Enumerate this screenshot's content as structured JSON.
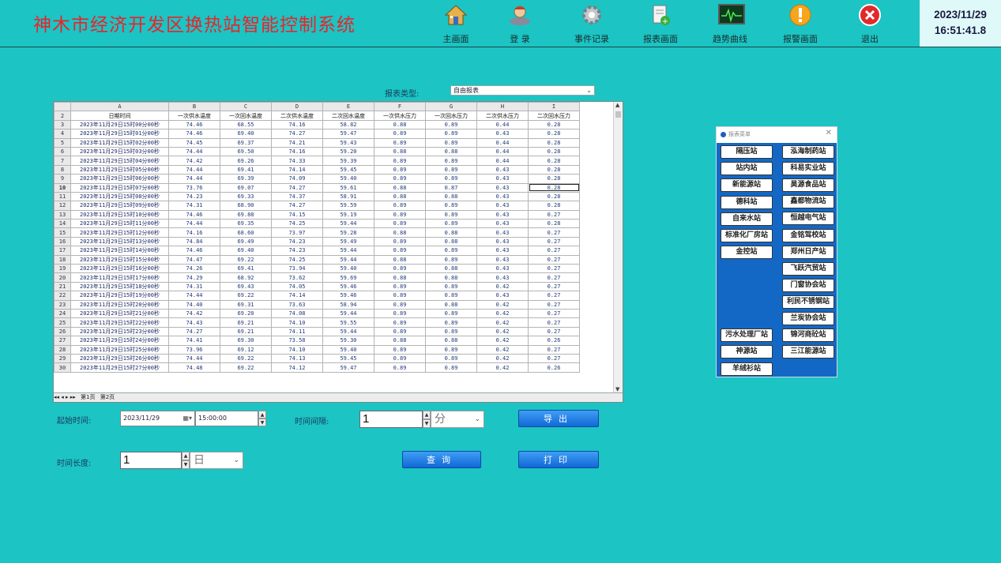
{
  "header": {
    "title": "神木市经济开发区换热站智能控制系统",
    "nav": [
      {
        "label": "主画面",
        "icon": "home-icon"
      },
      {
        "label": "登  录",
        "icon": "user-login-icon"
      },
      {
        "label": "事件记录",
        "icon": "gear-event-icon"
      },
      {
        "label": "报表画面",
        "icon": "report-add-icon"
      },
      {
        "label": "趋势曲线",
        "icon": "trend-monitor-icon"
      },
      {
        "label": "报警画面",
        "icon": "alarm-icon"
      },
      {
        "label": "退出",
        "icon": "exit-icon"
      }
    ],
    "date": "2023/11/29",
    "time": "16:51:41.8"
  },
  "report_type": {
    "label": "报表类型:",
    "value": "自由报表"
  },
  "sheet": {
    "col_letters": [
      "A",
      "B",
      "C",
      "D",
      "E",
      "F",
      "G",
      "H",
      "I"
    ],
    "headers": [
      "日期时间",
      "一次供水温度",
      "一次回水温度",
      "二次供水温度",
      "二次回水温度",
      "一次供水压力",
      "一次回水压力",
      "二次供水压力",
      "二次回水压力"
    ],
    "rows": [
      [
        "2023年11月29日15时00分00秒",
        "74.46",
        "68.55",
        "74.16",
        "58.82",
        "0.88",
        "0.89",
        "0.44",
        "0.28"
      ],
      [
        "2023年11月29日15时01分00秒",
        "74.46",
        "69.40",
        "74.27",
        "59.47",
        "0.89",
        "0.89",
        "0.43",
        "0.28"
      ],
      [
        "2023年11月29日15时02分00秒",
        "74.45",
        "69.37",
        "74.21",
        "59.43",
        "0.89",
        "0.89",
        "0.44",
        "0.28"
      ],
      [
        "2023年11月29日15时03分00秒",
        "74.44",
        "69.50",
        "74.16",
        "59.20",
        "0.88",
        "0.88",
        "0.44",
        "0.28"
      ],
      [
        "2023年11月29日15时04分00秒",
        "74.42",
        "69.26",
        "74.33",
        "59.39",
        "0.89",
        "0.89",
        "0.44",
        "0.28"
      ],
      [
        "2023年11月29日15时05分00秒",
        "74.44",
        "69.41",
        "74.14",
        "59.45",
        "0.89",
        "0.89",
        "0.43",
        "0.28"
      ],
      [
        "2023年11月29日15时06分00秒",
        "74.44",
        "69.39",
        "74.09",
        "59.40",
        "0.89",
        "0.89",
        "0.43",
        "0.28"
      ],
      [
        "2023年11月29日15时07分00秒",
        "73.76",
        "69.07",
        "74.27",
        "59.61",
        "0.88",
        "0.87",
        "0.43",
        "0.28"
      ],
      [
        "2023年11月29日15时08分00秒",
        "74.23",
        "69.33",
        "74.37",
        "58.91",
        "0.88",
        "0.88",
        "0.43",
        "0.28"
      ],
      [
        "2023年11月29日15时09分00秒",
        "74.31",
        "68.90",
        "74.27",
        "59.59",
        "0.89",
        "0.89",
        "0.43",
        "0.28"
      ],
      [
        "2023年11月29日15时10分00秒",
        "74.46",
        "69.88",
        "74.15",
        "59.19",
        "0.89",
        "0.89",
        "0.43",
        "0.27"
      ],
      [
        "2023年11月29日15时11分00秒",
        "74.44",
        "69.35",
        "74.25",
        "59.44",
        "0.89",
        "0.89",
        "0.43",
        "0.28"
      ],
      [
        "2023年11月29日15时12分00秒",
        "74.16",
        "68.60",
        "73.97",
        "59.28",
        "0.88",
        "0.88",
        "0.43",
        "0.27"
      ],
      [
        "2023年11月29日15时13分00秒",
        "74.84",
        "69.49",
        "74.23",
        "59.49",
        "0.89",
        "0.88",
        "0.43",
        "0.27"
      ],
      [
        "2023年11月29日15时14分00秒",
        "74.46",
        "69.40",
        "74.23",
        "59.44",
        "0.89",
        "0.89",
        "0.43",
        "0.27"
      ],
      [
        "2023年11月29日15时15分00秒",
        "74.47",
        "69.22",
        "74.25",
        "59.44",
        "0.88",
        "0.89",
        "0.43",
        "0.27"
      ],
      [
        "2023年11月29日15时16分00秒",
        "74.26",
        "69.41",
        "73.94",
        "59.40",
        "0.89",
        "0.88",
        "0.43",
        "0.27"
      ],
      [
        "2023年11月29日15时17分00秒",
        "74.29",
        "68.92",
        "73.62",
        "59.69",
        "0.88",
        "0.88",
        "0.43",
        "0.27"
      ],
      [
        "2023年11月29日15时18分00秒",
        "74.31",
        "69.43",
        "74.05",
        "59.46",
        "0.89",
        "0.89",
        "0.42",
        "0.27"
      ],
      [
        "2023年11月29日15时19分00秒",
        "74.44",
        "69.22",
        "74.14",
        "59.46",
        "0.89",
        "0.89",
        "0.43",
        "0.27"
      ],
      [
        "2023年11月29日15时20分00秒",
        "74.40",
        "69.31",
        "73.63",
        "58.94",
        "0.89",
        "0.88",
        "0.42",
        "0.27"
      ],
      [
        "2023年11月29日15时21分00秒",
        "74.42",
        "69.20",
        "74.08",
        "59.44",
        "0.89",
        "0.89",
        "0.42",
        "0.27"
      ],
      [
        "2023年11月29日15时22分00秒",
        "74.43",
        "69.21",
        "74.10",
        "59.55",
        "0.89",
        "0.89",
        "0.42",
        "0.27"
      ],
      [
        "2023年11月29日15时23分00秒",
        "74.27",
        "69.21",
        "74.11",
        "59.44",
        "0.89",
        "0.89",
        "0.42",
        "0.27"
      ],
      [
        "2023年11月29日15时24分00秒",
        "74.41",
        "69.30",
        "73.58",
        "59.30",
        "0.88",
        "0.88",
        "0.42",
        "0.26"
      ],
      [
        "2023年11月29日15时25分00秒",
        "73.96",
        "69.12",
        "74.10",
        "59.40",
        "0.89",
        "0.89",
        "0.42",
        "0.27"
      ],
      [
        "2023年11月29日15时26分00秒",
        "74.44",
        "69.22",
        "74.13",
        "59.45",
        "0.89",
        "0.89",
        "0.42",
        "0.27"
      ],
      [
        "2023年11月29日15时27分00秒",
        "74.48",
        "69.22",
        "74.12",
        "59.47",
        "0.89",
        "0.89",
        "0.42",
        "0.26"
      ]
    ],
    "tabs": [
      "◂◂ ◂ ▸ ▸▸",
      "第1页",
      "第2页"
    ]
  },
  "controls": {
    "start_label": "起始时间:",
    "start_date": "2023/11/29",
    "start_time": "15:00:00",
    "interval_label": "时间间隔:",
    "interval_value": "1",
    "interval_unit": "分",
    "length_label": "时间长度:",
    "length_value": "1",
    "length_unit": "日",
    "export_label": "导出",
    "query_label": "查询",
    "print_label": "打印"
  },
  "station_panel": {
    "title": "报表菜单",
    "left": [
      "隔压站",
      "站内站",
      "新能源站",
      "德科站",
      "自来水站",
      "标准化厂房站",
      "金控站",
      "污水处理厂站",
      "神源站",
      "羊绒衫站"
    ],
    "right": [
      "泓海制药站",
      "科易实业站",
      "昊源食品站",
      "鑫都物流站",
      "恒越电气站",
      "金铭驾校站",
      "郑州日产站",
      "飞跃汽贸站",
      "门窗协会站",
      "利民不锈钢站",
      "兰炭协会站",
      "锦河商砼站",
      "三江能源站"
    ]
  }
}
